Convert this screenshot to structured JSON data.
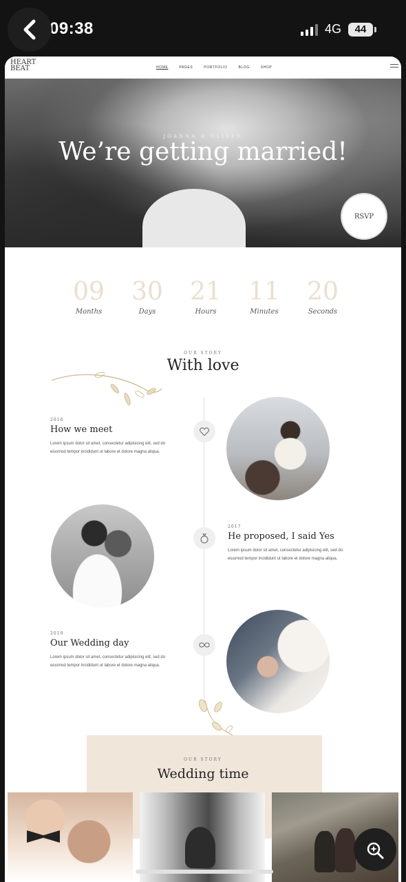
{
  "status_bar": {
    "time": "09:38",
    "network": "4G",
    "battery": "44"
  },
  "site": {
    "logo_line1": "HEART",
    "logo_line2": "BEAT",
    "nav": [
      "HOME",
      "PAGES",
      "PORTFOLIO",
      "BLOG",
      "SHOP"
    ]
  },
  "hero": {
    "kicker": "JOANNA & OLIVER",
    "headline": "We’re getting married!",
    "rsvp": "RSVP"
  },
  "countdown": [
    {
      "value": "09",
      "label": "Months"
    },
    {
      "value": "30",
      "label": "Days"
    },
    {
      "value": "21",
      "label": "Hours"
    },
    {
      "value": "11",
      "label": "Minutes"
    },
    {
      "value": "20",
      "label": "Seconds"
    }
  ],
  "story": {
    "eyebrow": "OUR STORY",
    "title": "With love",
    "items": [
      {
        "year": "2016",
        "title": "How we meet",
        "text": "Lorem ipsum dolor sit amet, consectetur adipisicing elit, sed do eiusmod tempor incididunt ut labore et dolore magna aliqua."
      },
      {
        "year": "2017",
        "title": "He proposed, I said Yes",
        "text": "Lorem ipsum dolor sit amet, consectetur adipisicing elit, sed do eiusmod tempor incididunt ut labore et dolore magna aliqua."
      },
      {
        "year": "2019",
        "title": "Our Wedding day",
        "text": "Lorem ipsum dolor sit amet, consectetur adipisicing elit, sed do eiusmod tempor incididunt ut labore et dolore magna aliqua."
      }
    ]
  },
  "wedding_time": {
    "eyebrow": "OUR STORY",
    "title": "Wedding time"
  },
  "icons": {
    "back": "chevron-left-icon",
    "fab": "search-sparkle-icon",
    "timeline": [
      "heart-icon",
      "ring-icon",
      "infinity-icon"
    ]
  }
}
